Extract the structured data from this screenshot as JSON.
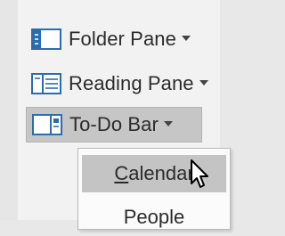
{
  "ribbon": {
    "buttons": [
      {
        "label": "Folder Pane",
        "icon": "folder-pane-icon"
      },
      {
        "label": "Reading Pane",
        "icon": "reading-pane-icon"
      },
      {
        "label": "To-Do Bar",
        "icon": "todo-bar-icon"
      }
    ]
  },
  "menu": {
    "items": [
      {
        "label_prefix": "",
        "label_mnemonic": "C",
        "label_rest": "alendar"
      },
      {
        "label": "People"
      }
    ]
  },
  "colors": {
    "icon_blue": "#2b6cb0",
    "selected_bg": "#c4c4c4"
  }
}
